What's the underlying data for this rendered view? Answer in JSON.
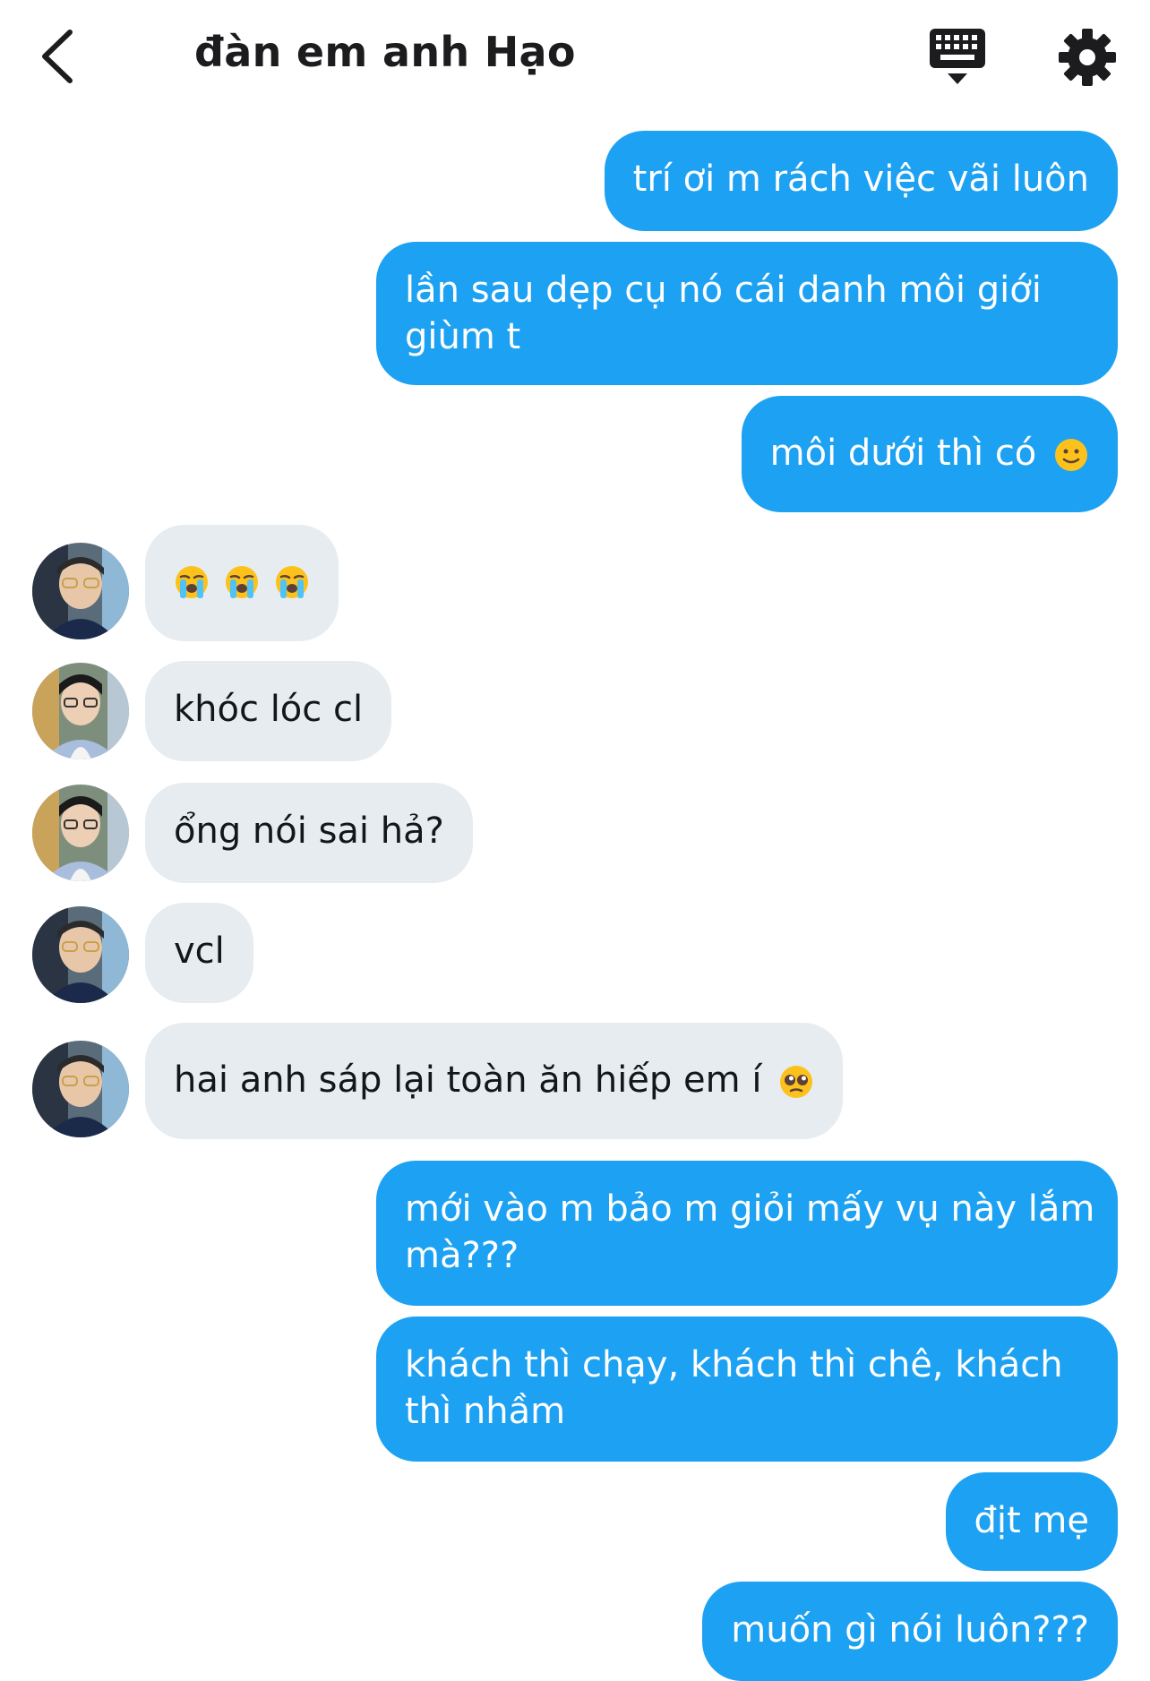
{
  "header": {
    "title": "đàn em anh Hạo",
    "back_icon": "chevron-left-icon",
    "keyboard_icon": "keyboard-icon",
    "settings_icon": "gear-icon"
  },
  "colors": {
    "outgoing_bubble": "#1da1f2",
    "incoming_bubble": "#e6ecf0"
  },
  "messages": [
    {
      "direction": "outgoing",
      "text": "trí ơi m rách việc vãi luôn"
    },
    {
      "direction": "outgoing",
      "text": "lần sau dẹp cụ nó cái danh môi giới",
      "text2": "giùm t"
    },
    {
      "direction": "outgoing",
      "text": "môi dưới thì có",
      "emoji": "slightly-smiling-face-emoji"
    },
    {
      "direction": "incoming",
      "emojis": [
        "loudly-crying-face-emoji",
        "loudly-crying-face-emoji",
        "loudly-crying-face-emoji"
      ]
    },
    {
      "direction": "incoming",
      "text": "khóc lóc cl"
    },
    {
      "direction": "incoming",
      "text": "ổng nói sai hả?"
    },
    {
      "direction": "incoming",
      "text": "vcl"
    },
    {
      "direction": "incoming",
      "text": "hai anh sáp lại toàn ăn hiếp em í",
      "emoji": "pleading-face-emoji"
    },
    {
      "direction": "outgoing",
      "text": "mới vào m bảo m giỏi mấy vụ này lắm",
      "text2": "mà???"
    },
    {
      "direction": "outgoing",
      "text": "khách thì chạy, khách thì chê, khách",
      "text2": "thì nhầm"
    },
    {
      "direction": "outgoing",
      "text": "địt mẹ"
    },
    {
      "direction": "outgoing",
      "text": "muốn gì nói luôn???"
    }
  ]
}
